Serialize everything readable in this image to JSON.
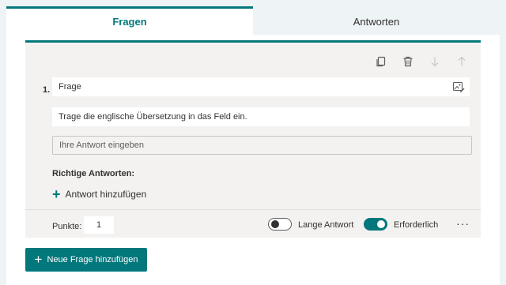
{
  "tabs": [
    {
      "label": "Fragen",
      "active": true
    },
    {
      "label": "Antworten",
      "active": false
    }
  ],
  "toolbar": {
    "icons": [
      "copy-icon",
      "trash-icon",
      "arrow-down-icon",
      "arrow-up-icon"
    ]
  },
  "question": {
    "number": "1.",
    "title": "Frage",
    "subtitle": "Trage die englische Übersetzung in das Feld ein.",
    "answer_placeholder": "Ihre Antwort eingeben",
    "correct_answers_label": "Richtige Antworten:",
    "add_answer_label": "Antwort hinzufügen"
  },
  "footer": {
    "points_label": "Punkte:",
    "points_value": "1",
    "long_answer_label": "Lange Antwort",
    "long_answer_on": false,
    "required_label": "Erforderlich",
    "required_on": true,
    "more_label": "···"
  },
  "add_question_label": "Neue Frage hinzufügen",
  "colors": {
    "accent": "#03787c",
    "card_bg": "#f3f2f1",
    "page_bg": "#eef3f5"
  }
}
